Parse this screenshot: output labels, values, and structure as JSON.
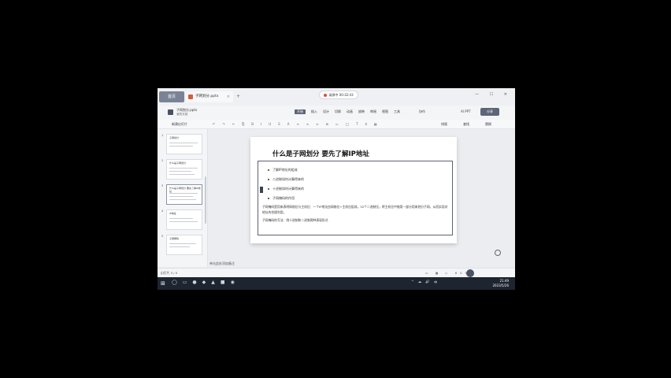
{
  "titlebar": {
    "home_label": "首页",
    "doc_tab": "子网划分.pptx",
    "new_tab": "+",
    "record_status": "录屏中 00:32:43",
    "window_controls": "— ☐ ✕"
  },
  "filebar": {
    "file_name": "子网划分.pptx",
    "file_sub": "我的文档",
    "menus": [
      "开始",
      "插入",
      "设计",
      "切换",
      "动画",
      "放映",
      "审阅",
      "视图",
      "工具"
    ],
    "active_menu": "开始",
    "collab": "协作",
    "aippt": "AI PPT",
    "share": "分享"
  },
  "toolbar": {
    "new_slide": "新建幻灯片",
    "tools": [
      "↶",
      "↷",
      "✂",
      "⎘",
      "B",
      "I",
      "U",
      "S",
      "A",
      "≡",
      "≡",
      "≡",
      "⊞",
      "▭",
      "◯",
      "T",
      "⌗",
      "▦"
    ],
    "right_tools": [
      "排版",
      "查找",
      "替换"
    ]
  },
  "thumbnails": [
    {
      "num": "1",
      "title": "子网划分"
    },
    {
      "num": "2",
      "title": "什么是子网划分"
    },
    {
      "num": "3",
      "title": "什么是子网划分 要先了解IP地址"
    },
    {
      "num": "4",
      "title": "IP地址"
    },
    {
      "num": "5",
      "title": "子网掩码"
    }
  ],
  "slide": {
    "title": "什么是子网划分  要先了解IP地址",
    "bullets": [
      "了解IP地址的组成",
      "二进制如何计算得来的",
      "十进制如何计算得来的",
      "子网掩码的作用"
    ],
    "paragraph": "子网掩码是用来表明网络位与主机位：一个IP地址由网络位+主机位组成，32个二进制位，将主机位中借用一部分用来划分子网，从而实现对地址的合理利用。",
    "paragraph2": "子网掩码的写法：例十进制和二进制两种表现形式"
  },
  "notes": "单击此处添加备注",
  "status": {
    "slide_count": "幻灯片 3 / 5",
    "views": "▭ ▦ ▷ 80%"
  },
  "taskbar": {
    "start": "⊞",
    "icons": [
      "◯",
      "▭",
      "●",
      "◆",
      "▲",
      "■",
      "◉"
    ],
    "tray": [
      "^",
      "☁",
      "🔊",
      "中"
    ],
    "time": "21:49",
    "date": "2023/5/26"
  }
}
